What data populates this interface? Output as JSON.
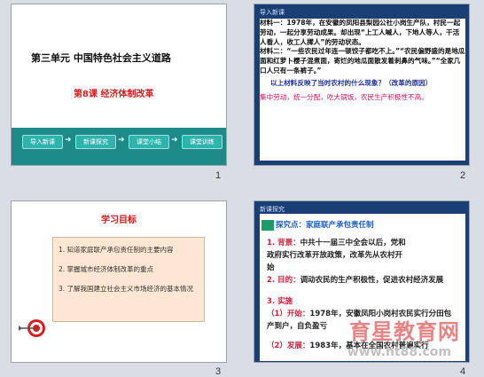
{
  "slides": [
    {
      "number": "1",
      "title": "第三单元  中国特色社会主义道路",
      "subtitle": "第8课  经济体制改革",
      "buttons": [
        "导入新课",
        "新课探究",
        "课堂小结",
        "课堂训练"
      ]
    },
    {
      "number": "2",
      "header": "导入新课",
      "paragraphs": [
        "材料一：1978年，在安徽的凤阳县梨园公社小岗生产队，村民一起劳动，一起分享劳动成果。却出现“上工人喊人，下地人等人，干活人看人，收工人撵人”的劳动状态。",
        "材料二：“一些农民过年连一顿饺子都吃不上。”“农民偏野盛的是地瓜面和红萝卜樱子混煮面，寄烂的地瓜面散发着刺鼻的气味。”“全家几口人只有一条裤子。”"
      ],
      "question": "以上材料反映了当时农村的什么现象？（改革的原因）",
      "answer": "集中劳动，统一分配，吃大锅饭，农民生产积极性不高。"
    },
    {
      "number": "3",
      "title": "学习目标",
      "items": [
        "1. 知道家庭联产承包责任制的主要内容",
        "2. 掌握城市经济体制改革的重点",
        "3. 了解我国建立社会主义市场经济的基本情况"
      ]
    },
    {
      "number": "4",
      "header": "新课探究",
      "section": "探究点：家庭联产承包责任制",
      "lines": [
        {
          "label": "1. 背景：",
          "text": "中共十一届三中全会以后，党和政府实行改革开放政策，改革先从农村开始"
        },
        {
          "label": "2. 目的：",
          "text": "调动农民的生产积极性，促进农村经济发展"
        },
        {
          "label": "3. 实施",
          "text": ""
        },
        {
          "label": "（1）开始：",
          "text": "1978年，安徽凤阳小岗村农民实行分田包产到户，自负盈亏"
        },
        {
          "label": "（2）发展：",
          "text": "1983年，基本在全国农村普遍实行"
        }
      ],
      "watermark": "育星教育网",
      "watermark_url": "www.ht88.com"
    }
  ]
}
